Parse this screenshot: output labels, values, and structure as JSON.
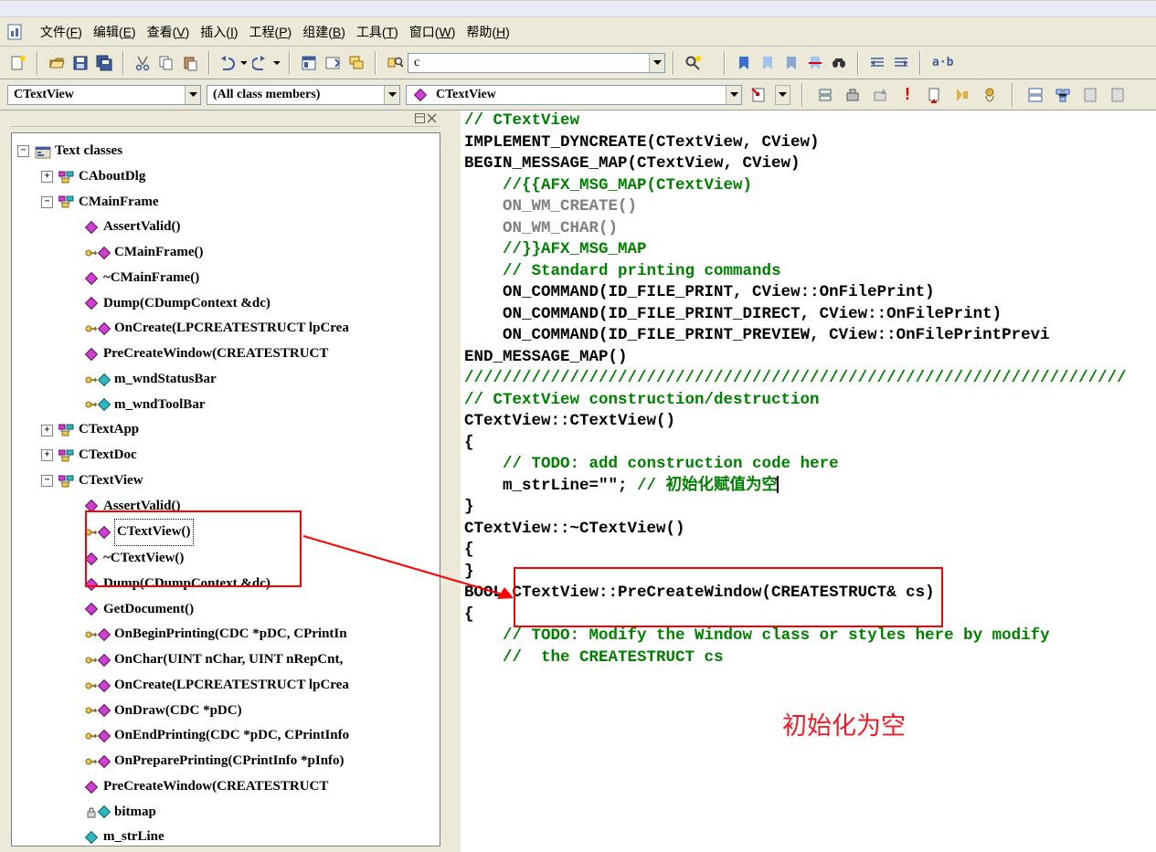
{
  "menus": [
    {
      "label": "文件",
      "hotkey": "F"
    },
    {
      "label": "编辑",
      "hotkey": "E"
    },
    {
      "label": "查看",
      "hotkey": "V"
    },
    {
      "label": "插入",
      "hotkey": "I"
    },
    {
      "label": "工程",
      "hotkey": "P"
    },
    {
      "label": "组建",
      "hotkey": "B"
    },
    {
      "label": "工具",
      "hotkey": "T"
    },
    {
      "label": "窗口",
      "hotkey": "W"
    },
    {
      "label": "帮助",
      "hotkey": "H"
    }
  ],
  "find_combo": "c",
  "nav": {
    "class_combo": "CTextView",
    "member_combo": "(All class members)",
    "function_combo": "CTextView"
  },
  "tree": {
    "root": "Text classes",
    "nodes": [
      {
        "type": "class",
        "expanded": false,
        "label": "CAboutDlg"
      },
      {
        "type": "class",
        "expanded": true,
        "label": "CMainFrame",
        "children": [
          {
            "kind": "pub-fn",
            "label": "AssertValid()"
          },
          {
            "kind": "prot-fn",
            "label": "CMainFrame()"
          },
          {
            "kind": "pub-fn",
            "label": "~CMainFrame()"
          },
          {
            "kind": "pub-fn",
            "label": "Dump(CDumpContext &dc)"
          },
          {
            "kind": "prot-fn",
            "label": "OnCreate(LPCREATESTRUCT lpCrea"
          },
          {
            "kind": "pub-fn",
            "label": "PreCreateWindow(CREATESTRUCT"
          },
          {
            "kind": "prot-var",
            "label": "m_wndStatusBar"
          },
          {
            "kind": "prot-var",
            "label": "m_wndToolBar"
          }
        ]
      },
      {
        "type": "class",
        "expanded": false,
        "label": "CTextApp"
      },
      {
        "type": "class",
        "expanded": false,
        "label": "CTextDoc"
      },
      {
        "type": "class",
        "expanded": true,
        "label": "CTextView",
        "children": [
          {
            "kind": "pub-fn",
            "label": "AssertValid()",
            "boxed": true
          },
          {
            "kind": "prot-fn",
            "label": "CTextView()",
            "boxed": true,
            "selected": true
          },
          {
            "kind": "pub-fn",
            "label": "~CTextView()",
            "boxed": true
          },
          {
            "kind": "pub-fn",
            "label": "Dump(CDumpContext &dc)"
          },
          {
            "kind": "pub-fn",
            "label": "GetDocument()"
          },
          {
            "kind": "prot-fn",
            "label": "OnBeginPrinting(CDC *pDC, CPrintIn"
          },
          {
            "kind": "prot-fn",
            "label": "OnChar(UINT nChar, UINT nRepCnt,"
          },
          {
            "kind": "prot-fn",
            "label": "OnCreate(LPCREATESTRUCT lpCrea"
          },
          {
            "kind": "prot-fn",
            "label": "OnDraw(CDC *pDC)"
          },
          {
            "kind": "prot-fn",
            "label": "OnEndPrinting(CDC *pDC, CPrintInfo"
          },
          {
            "kind": "prot-fn",
            "label": "OnPreparePrinting(CPrintInfo *pInfo)"
          },
          {
            "kind": "pub-fn",
            "label": "PreCreateWindow(CREATESTRUCT"
          },
          {
            "kind": "priv-var",
            "label": "bitmap"
          },
          {
            "kind": "pub-var",
            "label": "m_strLine"
          }
        ]
      }
    ]
  },
  "code": [
    {
      "cls": "c-green",
      "t": "// CTextView"
    },
    {
      "cls": "",
      "t": ""
    },
    {
      "cls": "c-black",
      "t": "IMPLEMENT_DYNCREATE(CTextView, CView)"
    },
    {
      "cls": "",
      "t": ""
    },
    {
      "cls": "c-black",
      "t": "BEGIN_MESSAGE_MAP(CTextView, CView)"
    },
    {
      "cls": "",
      "t": "    ",
      "runs": [
        {
          "cls": "c-green",
          "t": "//{{AFX_MSG_MAP(CTextView)"
        }
      ]
    },
    {
      "cls": "",
      "t": "    ",
      "runs": [
        {
          "cls": "c-gray",
          "t": "ON_WM_CREATE()"
        }
      ]
    },
    {
      "cls": "",
      "t": "    ",
      "runs": [
        {
          "cls": "c-gray",
          "t": "ON_WM_CHAR()"
        }
      ]
    },
    {
      "cls": "",
      "t": "    ",
      "runs": [
        {
          "cls": "c-green",
          "t": "//}}AFX_MSG_MAP"
        }
      ]
    },
    {
      "cls": "",
      "t": "    ",
      "runs": [
        {
          "cls": "c-green",
          "t": "// Standard printing commands"
        }
      ]
    },
    {
      "cls": "",
      "t": "    ",
      "runs": [
        {
          "cls": "c-black",
          "t": "ON_COMMAND(ID_FILE_PRINT, CView::OnFilePrint)"
        }
      ]
    },
    {
      "cls": "",
      "t": "    ",
      "runs": [
        {
          "cls": "c-black",
          "t": "ON_COMMAND(ID_FILE_PRINT_DIRECT, CView::OnFilePrint)"
        }
      ]
    },
    {
      "cls": "",
      "t": "    ",
      "runs": [
        {
          "cls": "c-black",
          "t": "ON_COMMAND(ID_FILE_PRINT_PREVIEW, CView::OnFilePrintPrevi"
        }
      ]
    },
    {
      "cls": "c-black",
      "t": "END_MESSAGE_MAP()"
    },
    {
      "cls": "",
      "t": ""
    },
    {
      "cls": "c-green",
      "t": "/////////////////////////////////////////////////////////////////////"
    },
    {
      "cls": "c-green",
      "t": "// CTextView construction/destruction"
    },
    {
      "cls": "",
      "t": ""
    },
    {
      "cls": "c-black",
      "t": "CTextView::CTextView()"
    },
    {
      "cls": "c-black",
      "t": "{"
    },
    {
      "cls": "",
      "t": "    ",
      "runs": [
        {
          "cls": "c-green",
          "t": "// TODO: add construction code here"
        }
      ],
      "boxstart": true
    },
    {
      "cls": "",
      "t": "    ",
      "runs": [
        {
          "cls": "c-black",
          "t": "m_strLine=\"\"; "
        },
        {
          "cls": "c-green",
          "t": "// 初始化赋值为空"
        }
      ],
      "boxend": true,
      "cursor": true
    },
    {
      "cls": "",
      "t": ""
    },
    {
      "cls": "c-black",
      "t": "}"
    },
    {
      "cls": "",
      "t": ""
    },
    {
      "cls": "c-black",
      "t": "CTextView::~CTextView()"
    },
    {
      "cls": "c-black",
      "t": "{"
    },
    {
      "cls": "c-black",
      "t": "}"
    },
    {
      "cls": "",
      "t": ""
    },
    {
      "cls": "c-black",
      "t": "BOOL CTextView::PreCreateWindow(CREATESTRUCT& cs)"
    },
    {
      "cls": "c-black",
      "t": "{"
    },
    {
      "cls": "",
      "t": "    ",
      "runs": [
        {
          "cls": "c-green",
          "t": "// TODO: Modify the Window class or styles here by modify"
        }
      ]
    },
    {
      "cls": "",
      "t": "    ",
      "runs": [
        {
          "cls": "c-green",
          "t": "//  the CREATESTRUCT cs"
        }
      ]
    }
  ],
  "annotation": "初始化为空"
}
